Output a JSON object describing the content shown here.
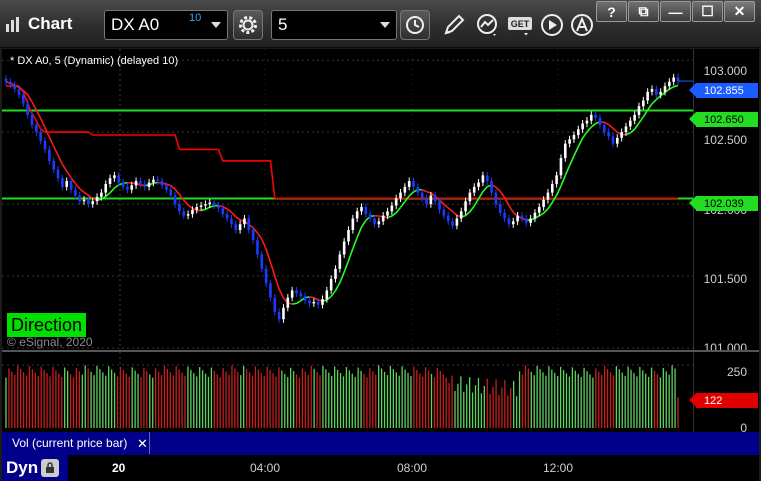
{
  "app": {
    "title": "Chart",
    "symbol": "DX A0",
    "symbol_badge": "10",
    "interval": "5",
    "window_buttons": [
      "?",
      "⧉",
      "—",
      "☐",
      "✕"
    ]
  },
  "toolbar_icons": [
    "settings-gear-icon",
    "clock-icon",
    "pencil-icon",
    "study-icon",
    "get-icon",
    "play-icon",
    "alert-icon"
  ],
  "toolbar": {
    "get_label": "GET"
  },
  "price_pane": {
    "chart_label": "* DX A0, 5 (Dynamic) (delayed 10)",
    "direction_label": "Direction",
    "copyright": "© eSignal, 2020",
    "ticks": [
      "103.000",
      "102.500",
      "102.000",
      "101.500",
      "101.000"
    ],
    "tag_last": "102.855",
    "tag_upper": "102.650",
    "tag_lower": "102.039"
  },
  "volume_pane": {
    "label": "Vol (current price bar)",
    "close": "✕",
    "ticks": [
      "250",
      "0"
    ],
    "tag_current": "122"
  },
  "time_axis": {
    "dyn_label": "Dyn",
    "labels": [
      "20",
      "04:00",
      "08:00",
      "12:00"
    ]
  },
  "colors": {
    "background": "#000000",
    "up_candle": "#ffffff",
    "down_candle": "#1a3cff",
    "ma_fast_up": "#22ff22",
    "ma_fast_down": "#ff1a1a",
    "resistance_line": "#ff0000",
    "support_line": "#22dd22",
    "last_price": "#1a5cff"
  },
  "chart_data": [
    {
      "type": "candlestick",
      "title": "* DX A0, 5 (Dynamic) (delayed 10)",
      "ylim": [
        101.0,
        103.05
      ],
      "yticks": [
        103.0,
        102.5,
        102.0,
        101.5,
        101.0
      ],
      "x_tick_labels": [
        "20",
        "04:00",
        "08:00",
        "12:00"
      ],
      "close_series": [
        102.85,
        102.83,
        102.8,
        102.76,
        102.7,
        102.62,
        102.55,
        102.5,
        102.44,
        102.38,
        102.3,
        102.24,
        102.18,
        102.12,
        102.16,
        102.1,
        102.06,
        102.02,
        102.03,
        102.0,
        102.02,
        102.05,
        102.08,
        102.14,
        102.18,
        102.2,
        102.15,
        102.12,
        102.1,
        102.13,
        102.16,
        102.14,
        102.12,
        102.15,
        102.17,
        102.16,
        102.13,
        102.1,
        102.06,
        102.0,
        101.95,
        101.92,
        101.93,
        101.96,
        101.98,
        101.99,
        102.0,
        102.01,
        101.99,
        101.97,
        101.93,
        101.9,
        101.86,
        101.82,
        101.86,
        101.9,
        101.82,
        101.75,
        101.65,
        101.55,
        101.45,
        101.35,
        101.25,
        101.2,
        101.28,
        101.35,
        101.4,
        101.38,
        101.36,
        101.33,
        101.31,
        101.32,
        101.3,
        101.34,
        101.4,
        101.48,
        101.55,
        101.65,
        101.74,
        101.82,
        101.9,
        101.95,
        101.98,
        101.93,
        101.9,
        101.86,
        101.88,
        101.92,
        101.95,
        101.99,
        102.04,
        102.08,
        102.12,
        102.16,
        102.12,
        102.08,
        102.04,
        102.0,
        102.06,
        102.02,
        101.96,
        101.92,
        101.88,
        101.85,
        101.9,
        101.95,
        102.02,
        102.08,
        102.12,
        102.15,
        102.2,
        102.16,
        102.08,
        102.0,
        101.94,
        101.9,
        101.86,
        101.88,
        101.92,
        101.9,
        101.87,
        101.9,
        101.94,
        101.98,
        102.03,
        102.08,
        102.14,
        102.2,
        102.32,
        102.42,
        102.45,
        102.48,
        102.52,
        102.56,
        102.58,
        102.62,
        102.6,
        102.55,
        102.5,
        102.47,
        102.42,
        102.46,
        102.5,
        102.54,
        102.58,
        102.62,
        102.68,
        102.72,
        102.78,
        102.8,
        102.76,
        102.78,
        102.82,
        102.85,
        102.88,
        102.855
      ]
    },
    {
      "type": "bar",
      "title": "Vol (current price bar)",
      "ylim": [
        0,
        270
      ],
      "yticks": [
        250,
        0
      ],
      "current_value": 122
    }
  ]
}
